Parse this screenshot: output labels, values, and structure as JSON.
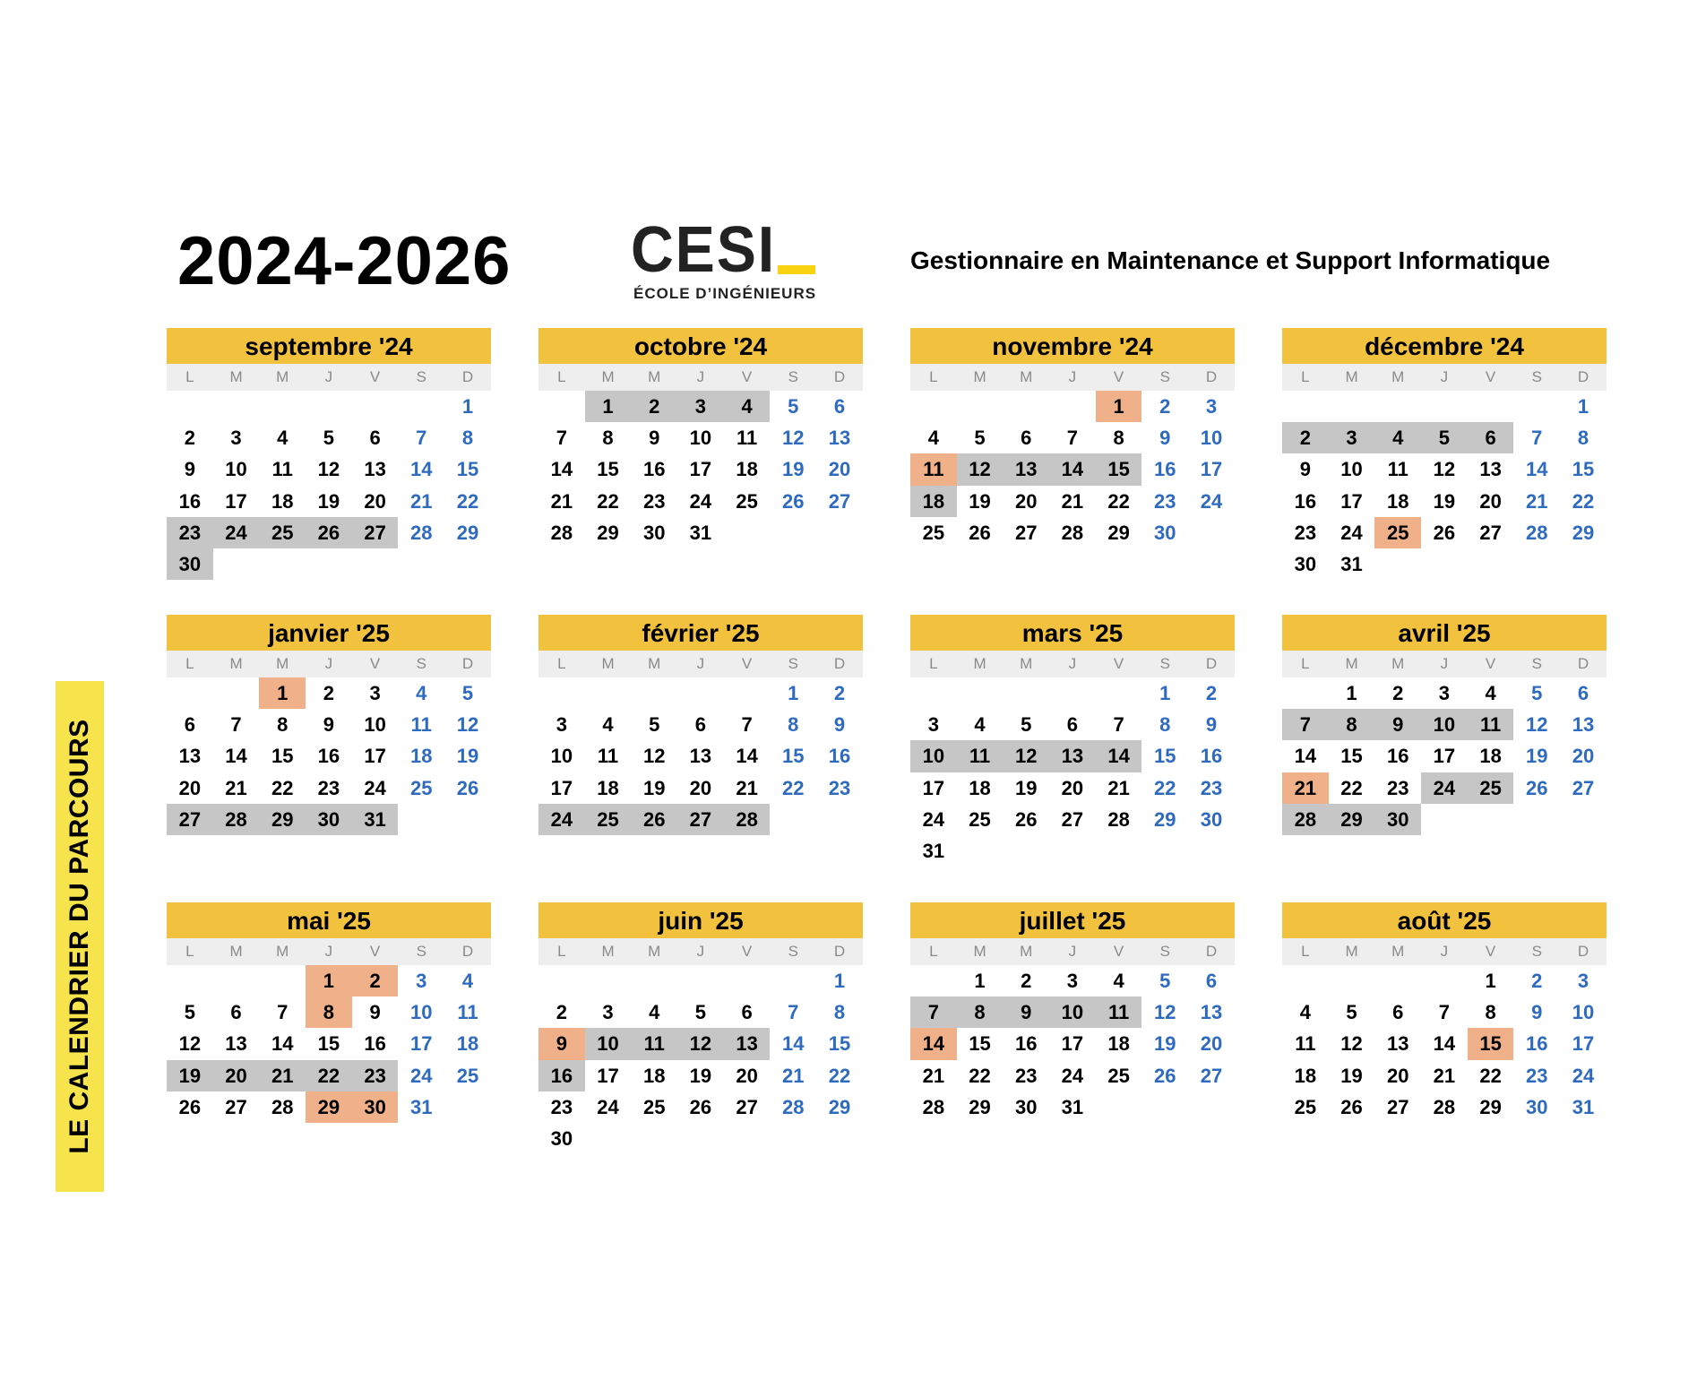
{
  "title": "2024-2026",
  "logo": {
    "word": "CESI",
    "subtitle": "ÉCOLE D’INGÉNIEURS"
  },
  "program": "Gestionnaire en Maintenance et Support Informatique",
  "side_label": "LE CALENDRIER DU PARCOURS",
  "weekday_labels": [
    "L",
    "M",
    "M",
    "J",
    "V",
    "S",
    "D"
  ],
  "colors": {
    "header": "#f2c23e",
    "grey_period": "#c6c6c6",
    "orange_day": "#f0b089",
    "weekend_text": "#2e6bc0",
    "side_label_bg": "#f7e34c"
  },
  "months": [
    {
      "label": "septembre '24",
      "start": 6,
      "days": 30,
      "grey": [
        23,
        24,
        25,
        26,
        27,
        30
      ],
      "orange": []
    },
    {
      "label": "octobre '24",
      "start": 1,
      "days": 31,
      "grey": [
        1,
        2,
        3,
        4
      ],
      "orange": []
    },
    {
      "label": "novembre '24",
      "start": 4,
      "days": 30,
      "grey": [
        11,
        12,
        13,
        14,
        15,
        18
      ],
      "orange": [
        1,
        11
      ]
    },
    {
      "label": "décembre '24",
      "start": 6,
      "days": 31,
      "grey": [
        2,
        3,
        4,
        5,
        6
      ],
      "orange": [
        25
      ]
    },
    {
      "label": "janvier '25",
      "start": 2,
      "days": 31,
      "grey": [
        27,
        28,
        29,
        30,
        31
      ],
      "orange": [
        1
      ]
    },
    {
      "label": "février '25",
      "start": 5,
      "days": 28,
      "grey": [
        24,
        25,
        26,
        27,
        28
      ],
      "orange": []
    },
    {
      "label": "mars '25",
      "start": 5,
      "days": 31,
      "grey": [
        10,
        11,
        12,
        13,
        14
      ],
      "orange": []
    },
    {
      "label": "avril '25",
      "start": 1,
      "days": 30,
      "grey": [
        7,
        8,
        9,
        10,
        11,
        24,
        25,
        28,
        29,
        30
      ],
      "orange": [
        21
      ]
    },
    {
      "label": "mai '25",
      "start": 3,
      "days": 31,
      "grey": [
        19,
        20,
        21,
        22,
        23
      ],
      "orange": [
        1,
        2,
        8,
        29,
        30
      ]
    },
    {
      "label": "juin '25",
      "start": 6,
      "days": 30,
      "grey": [
        10,
        11,
        12,
        13,
        16
      ],
      "orange": [
        9
      ]
    },
    {
      "label": "juillet '25",
      "start": 1,
      "days": 31,
      "grey": [
        7,
        8,
        9,
        10,
        11
      ],
      "orange": [
        14
      ]
    },
    {
      "label": "août '25",
      "start": 4,
      "days": 31,
      "grey": [],
      "orange": [
        15
      ]
    }
  ]
}
